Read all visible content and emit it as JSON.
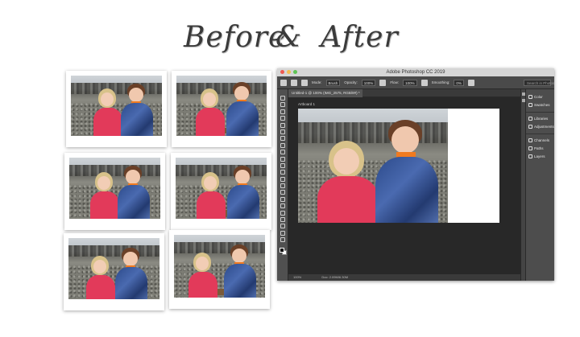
{
  "heading": {
    "word1": "Before",
    "ampersand": "&",
    "word2": "After"
  },
  "photoshop": {
    "window_title": "Adobe Photoshop CC 2019",
    "options": {
      "mode_label": "Mode:",
      "mode_value": "Brush",
      "opacity_label": "Opacity:",
      "opacity_value": "100%",
      "flow_label": "Flow:",
      "flow_value": "100%",
      "smoothing_label": "Smoothing:",
      "smoothing_value": "0%",
      "search_placeholder": "Search in Photos"
    },
    "document_tab": "Untitled-1 @ 100% (IMG_2575, RGB/8#) *",
    "artboard_label": "Artboard 1",
    "status": {
      "zoom": "100%",
      "doc": "Doc: 2.09M/6.30M"
    },
    "panels": [
      {
        "label": "Color",
        "icon": "color-icon"
      },
      {
        "label": "Swatches",
        "icon": "swatches-icon"
      },
      {
        "label": "Libraries",
        "icon": "libraries-icon"
      },
      {
        "label": "Adjustments",
        "icon": "adjustments-icon"
      },
      {
        "label": "Channels",
        "icon": "channels-icon"
      },
      {
        "label": "Paths",
        "icon": "paths-icon"
      },
      {
        "label": "Layers",
        "icon": "layers-icon"
      }
    ]
  },
  "colors": {
    "accent_pink": "#e23a5a",
    "accent_blue": "#2c4a8a",
    "ps_dark": "#282828"
  }
}
